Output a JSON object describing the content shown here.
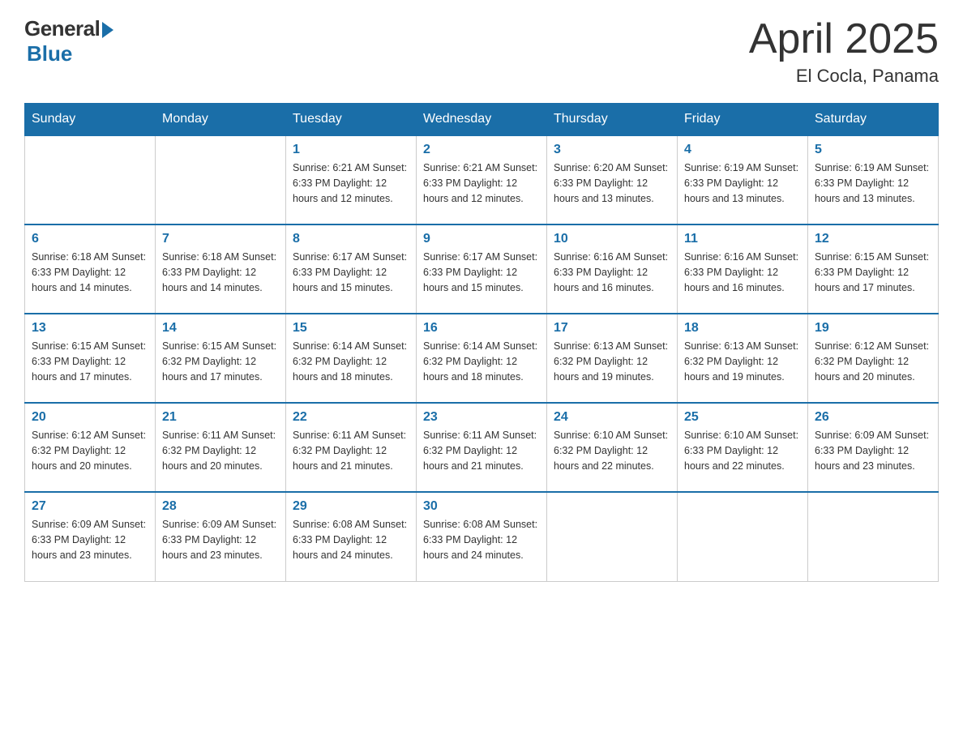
{
  "logo": {
    "general": "General",
    "blue": "Blue",
    "tagline": "Blue"
  },
  "title": {
    "month_year": "April 2025",
    "location": "El Cocla, Panama"
  },
  "header_days": [
    "Sunday",
    "Monday",
    "Tuesday",
    "Wednesday",
    "Thursday",
    "Friday",
    "Saturday"
  ],
  "weeks": [
    [
      {
        "day": "",
        "info": ""
      },
      {
        "day": "",
        "info": ""
      },
      {
        "day": "1",
        "info": "Sunrise: 6:21 AM\nSunset: 6:33 PM\nDaylight: 12 hours\nand 12 minutes."
      },
      {
        "day": "2",
        "info": "Sunrise: 6:21 AM\nSunset: 6:33 PM\nDaylight: 12 hours\nand 12 minutes."
      },
      {
        "day": "3",
        "info": "Sunrise: 6:20 AM\nSunset: 6:33 PM\nDaylight: 12 hours\nand 13 minutes."
      },
      {
        "day": "4",
        "info": "Sunrise: 6:19 AM\nSunset: 6:33 PM\nDaylight: 12 hours\nand 13 minutes."
      },
      {
        "day": "5",
        "info": "Sunrise: 6:19 AM\nSunset: 6:33 PM\nDaylight: 12 hours\nand 13 minutes."
      }
    ],
    [
      {
        "day": "6",
        "info": "Sunrise: 6:18 AM\nSunset: 6:33 PM\nDaylight: 12 hours\nand 14 minutes."
      },
      {
        "day": "7",
        "info": "Sunrise: 6:18 AM\nSunset: 6:33 PM\nDaylight: 12 hours\nand 14 minutes."
      },
      {
        "day": "8",
        "info": "Sunrise: 6:17 AM\nSunset: 6:33 PM\nDaylight: 12 hours\nand 15 minutes."
      },
      {
        "day": "9",
        "info": "Sunrise: 6:17 AM\nSunset: 6:33 PM\nDaylight: 12 hours\nand 15 minutes."
      },
      {
        "day": "10",
        "info": "Sunrise: 6:16 AM\nSunset: 6:33 PM\nDaylight: 12 hours\nand 16 minutes."
      },
      {
        "day": "11",
        "info": "Sunrise: 6:16 AM\nSunset: 6:33 PM\nDaylight: 12 hours\nand 16 minutes."
      },
      {
        "day": "12",
        "info": "Sunrise: 6:15 AM\nSunset: 6:33 PM\nDaylight: 12 hours\nand 17 minutes."
      }
    ],
    [
      {
        "day": "13",
        "info": "Sunrise: 6:15 AM\nSunset: 6:33 PM\nDaylight: 12 hours\nand 17 minutes."
      },
      {
        "day": "14",
        "info": "Sunrise: 6:15 AM\nSunset: 6:32 PM\nDaylight: 12 hours\nand 17 minutes."
      },
      {
        "day": "15",
        "info": "Sunrise: 6:14 AM\nSunset: 6:32 PM\nDaylight: 12 hours\nand 18 minutes."
      },
      {
        "day": "16",
        "info": "Sunrise: 6:14 AM\nSunset: 6:32 PM\nDaylight: 12 hours\nand 18 minutes."
      },
      {
        "day": "17",
        "info": "Sunrise: 6:13 AM\nSunset: 6:32 PM\nDaylight: 12 hours\nand 19 minutes."
      },
      {
        "day": "18",
        "info": "Sunrise: 6:13 AM\nSunset: 6:32 PM\nDaylight: 12 hours\nand 19 minutes."
      },
      {
        "day": "19",
        "info": "Sunrise: 6:12 AM\nSunset: 6:32 PM\nDaylight: 12 hours\nand 20 minutes."
      }
    ],
    [
      {
        "day": "20",
        "info": "Sunrise: 6:12 AM\nSunset: 6:32 PM\nDaylight: 12 hours\nand 20 minutes."
      },
      {
        "day": "21",
        "info": "Sunrise: 6:11 AM\nSunset: 6:32 PM\nDaylight: 12 hours\nand 20 minutes."
      },
      {
        "day": "22",
        "info": "Sunrise: 6:11 AM\nSunset: 6:32 PM\nDaylight: 12 hours\nand 21 minutes."
      },
      {
        "day": "23",
        "info": "Sunrise: 6:11 AM\nSunset: 6:32 PM\nDaylight: 12 hours\nand 21 minutes."
      },
      {
        "day": "24",
        "info": "Sunrise: 6:10 AM\nSunset: 6:32 PM\nDaylight: 12 hours\nand 22 minutes."
      },
      {
        "day": "25",
        "info": "Sunrise: 6:10 AM\nSunset: 6:33 PM\nDaylight: 12 hours\nand 22 minutes."
      },
      {
        "day": "26",
        "info": "Sunrise: 6:09 AM\nSunset: 6:33 PM\nDaylight: 12 hours\nand 23 minutes."
      }
    ],
    [
      {
        "day": "27",
        "info": "Sunrise: 6:09 AM\nSunset: 6:33 PM\nDaylight: 12 hours\nand 23 minutes."
      },
      {
        "day": "28",
        "info": "Sunrise: 6:09 AM\nSunset: 6:33 PM\nDaylight: 12 hours\nand 23 minutes."
      },
      {
        "day": "29",
        "info": "Sunrise: 6:08 AM\nSunset: 6:33 PM\nDaylight: 12 hours\nand 24 minutes."
      },
      {
        "day": "30",
        "info": "Sunrise: 6:08 AM\nSunset: 6:33 PM\nDaylight: 12 hours\nand 24 minutes."
      },
      {
        "day": "",
        "info": ""
      },
      {
        "day": "",
        "info": ""
      },
      {
        "day": "",
        "info": ""
      }
    ]
  ]
}
